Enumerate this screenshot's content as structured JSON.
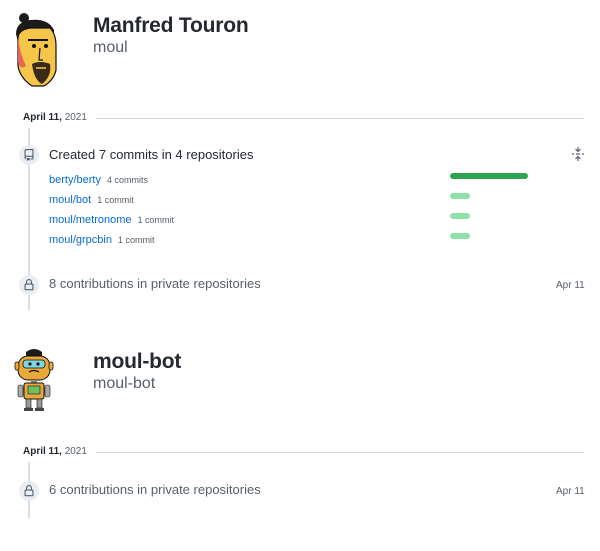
{
  "users": [
    {
      "name": "Manfred Touron",
      "login": "moul",
      "date_label": "April 11,",
      "date_year": "2021",
      "commits_event": {
        "title": "Created 7 commits in 4 repositories",
        "repos": [
          {
            "name": "berty/berty",
            "count": "4 commits",
            "fraction": 1.0
          },
          {
            "name": "moul/bot",
            "count": "1 commit",
            "fraction": 0.25
          },
          {
            "name": "moul/metronome",
            "count": "1 commit",
            "fraction": 0.25
          },
          {
            "name": "moul/grpcbin",
            "count": "1 commit",
            "fraction": 0.25
          }
        ]
      },
      "private_event": {
        "title": "8 contributions in private repositories",
        "when": "Apr 11"
      }
    },
    {
      "name": "moul-bot",
      "login": "moul-bot",
      "date_label": "April 11,",
      "date_year": "2021",
      "private_event": {
        "title": "6 contributions in private repositories",
        "when": "Apr 11"
      }
    }
  ],
  "icons": {
    "repo_push": "repo-push-icon",
    "lock": "lock-icon",
    "fold": "fold-icon"
  },
  "colors": {
    "link": "#0969da",
    "bar_high": "#2da44e",
    "bar_low": "#8fe0a7"
  }
}
